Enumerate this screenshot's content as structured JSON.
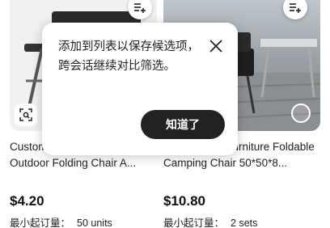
{
  "products": [
    {
      "title": "Custom Chair Lightweight Outdoor Folding Chair A...",
      "price": "$4.20",
      "moq_label": "最小起订量：",
      "moq_value": "50 units"
    },
    {
      "title": "...y-Carrying Furniture Foldable Camping Chair 50*50*8...",
      "price": "$10.80",
      "moq_label": "最小起订量：",
      "moq_value": "2 sets"
    }
  ],
  "tooltip": {
    "message": "添加到列表以保存候选项，跨会话继续对比筛选。",
    "confirm_label": "知道了",
    "close_icon": "close-icon"
  },
  "icons": [
    "add-to-list-icon",
    "image-search-icon",
    "select-circle-icon"
  ],
  "colors": {
    "confirm_button": "#222222",
    "tooltip_bg": "#ffffff"
  }
}
